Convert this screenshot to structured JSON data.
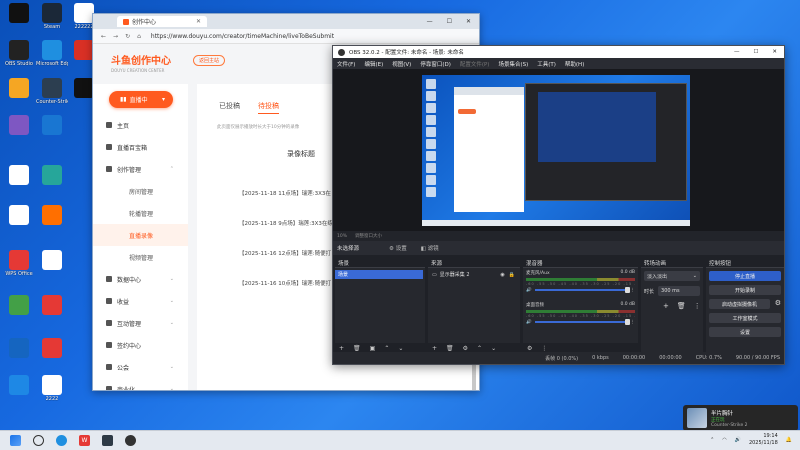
{
  "desktop": {
    "icons": [
      {
        "label": "",
        "color": "#111111"
      },
      {
        "label": "Steam",
        "color": "#1b2838"
      },
      {
        "label": "222222",
        "color": "#ffffff"
      },
      {
        "label": "OBS Studio",
        "color": "#222222"
      },
      {
        "label": "Microsoft Edge",
        "color": "#1f8fe0"
      },
      {
        "label": "",
        "color": "#d93025"
      },
      {
        "label": "",
        "color": "#f5a623"
      },
      {
        "label": "Counter-Strike 2",
        "color": "#2c3e50"
      },
      {
        "label": "",
        "color": "#111111"
      },
      {
        "label": "",
        "color": "#7e57c2"
      },
      {
        "label": "",
        "color": "#1976d2"
      },
      {
        "label": "",
        "color": "#ffffff"
      },
      {
        "label": "",
        "color": "#26a69a"
      },
      {
        "label": "",
        "color": "#ffffff"
      },
      {
        "label": "",
        "color": "#ff6f00"
      },
      {
        "label": "WPS Office",
        "color": "#e53935"
      },
      {
        "label": "",
        "color": "#ffffff"
      },
      {
        "label": "",
        "color": "#43a047"
      },
      {
        "label": "",
        "color": "#e53935"
      },
      {
        "label": "",
        "color": "#1565c0"
      },
      {
        "label": "",
        "color": "#e53935"
      },
      {
        "label": "",
        "color": "#1e88e5"
      },
      {
        "label": "2222",
        "color": "#ffffff"
      }
    ]
  },
  "browser": {
    "tab_title": "创作中心",
    "url": "https://www.douyu.com/creator/timeMachine/liveToBeSubmit",
    "logo_text": "斗鱼创作中心",
    "logo_sub": "DOUYU CREATION CENTER",
    "home_btn": "返回主站",
    "live_btn": "直播中",
    "menu": [
      {
        "label": "主页",
        "kind": "top"
      },
      {
        "label": "直播百宝箱",
        "kind": "top"
      },
      {
        "label": "创作管理",
        "kind": "top",
        "chevron": "⌃"
      },
      {
        "label": "房间管理",
        "kind": "sub"
      },
      {
        "label": "轮播管理",
        "kind": "sub"
      },
      {
        "label": "直播录像",
        "kind": "sub",
        "active": true
      },
      {
        "label": "视频管理",
        "kind": "sub"
      },
      {
        "label": "数据中心",
        "kind": "top",
        "chevron": "⌄"
      },
      {
        "label": "收益",
        "kind": "top",
        "chevron": "⌄"
      },
      {
        "label": "互动管理",
        "kind": "top",
        "chevron": "⌄"
      },
      {
        "label": "签约中心",
        "kind": "top"
      },
      {
        "label": "公会",
        "kind": "top",
        "chevron": "⌄"
      },
      {
        "label": "商业化",
        "kind": "top",
        "chevron": "⌄"
      }
    ],
    "tabs": [
      "已投稿",
      "待投稿"
    ],
    "note": "此页面仅展示播放时长大于10分钟的录像",
    "column_header": "录像标题",
    "rows": [
      "【2025-11-18 11点场】瑞莲:3X3在",
      "【2025-11-18 9点场】瑞莲:3X3在练",
      "【2025-11-16 12点场】瑞莲:随便打",
      "【2025-11-16 10点场】瑞莲:随便打"
    ]
  },
  "obs": {
    "title": "OBS 32.0.2 - 配置文件: 未命名 - 场景: 未命名",
    "menu": [
      "文件(F)",
      "编辑(E)",
      "视图(V)",
      "停靠窗口(D)",
      "配置文件(P)",
      "场景集合(S)",
      "工具(T)",
      "帮助(H)"
    ],
    "zoom": "10%",
    "zoom_hint": "调整窗口大小",
    "no_source": "未选择源",
    "settings_btn": "设置",
    "filters_btn": "滤镜",
    "scenes_title": "场景",
    "scene_item": "场景",
    "sources_title": "来源",
    "source_item": "显示器采集 2",
    "mixer_title": "混音器",
    "mixer": [
      {
        "name": "麦克风/Aux",
        "db": "0.0 dB"
      },
      {
        "name": "桌面音频",
        "db": "0.0 dB"
      }
    ],
    "mixer_scale": "-60 -55 -50 -45 -40 -35 -30 -25 -20 -15 -10 -5 0",
    "transitions_title": "转场动画",
    "transition": "淡入淡出",
    "duration_label": "时长",
    "duration": "300 ms",
    "controls_title": "控制按钮",
    "controls": [
      "停止直播",
      "开始录制",
      "启动虚拟摄像机",
      "工作室模式",
      "设置"
    ],
    "status": [
      "丢帧 0 (0.0%)",
      "0 kbps",
      "00:00:00",
      "00:00:00",
      "CPU: 0.7%",
      "90.00 / 90.00 FPS"
    ]
  },
  "toast": {
    "name": "半片胸针",
    "status": "正在玩",
    "game": "Counter-Strike 2"
  },
  "taskbar": {
    "time": "19:14",
    "date": "2025/11/18"
  }
}
